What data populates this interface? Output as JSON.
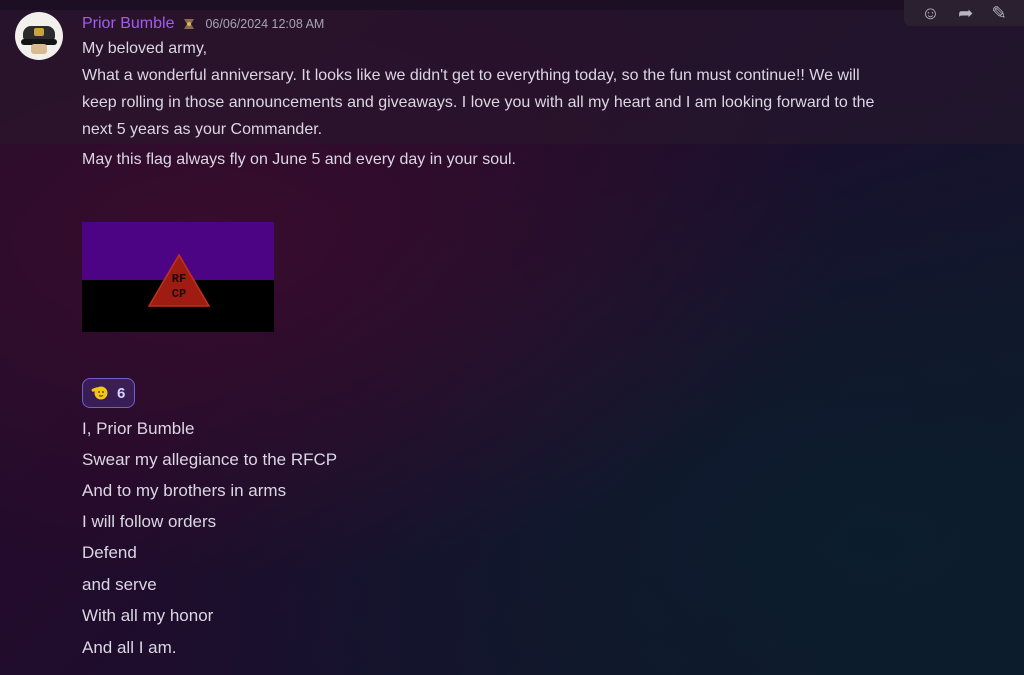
{
  "message": {
    "author": "Prior Bumble",
    "timestamp": "06/06/2024 12:08 AM",
    "lines": [
      "My beloved army,",
      "What a wonderful anniversary. It looks like we didn't get to everything today, so the fun must continue!! We will",
      "keep rolling in those announcements and giveaways. I love you with all my heart and I am looking forward to the",
      "next 5 years as your Commander."
    ],
    "followup": "May this flag always fly on June 5 and every day in your soul.",
    "attachment": {
      "flag_text_line1": "RF",
      "flag_text_line2": "CP",
      "colors": {
        "top": "#4d0484",
        "bottom": "#000000",
        "triangle": "#9e1c12"
      }
    },
    "reaction": {
      "emoji_name": "saluting-face-icon",
      "count": "6"
    }
  },
  "oath": {
    "lines": [
      "I, Prior Bumble",
      "Swear my allegiance to the RFCP",
      "And to my brothers in arms",
      "I will follow orders",
      "Defend",
      "and serve",
      "With all my honor",
      "And all I am."
    ]
  },
  "toolbar": {
    "icons": [
      "add-reaction-icon",
      "reply-icon",
      "edit-icon"
    ]
  },
  "colors": {
    "username": "#a25df0",
    "reaction_border": "#6e5ed1"
  }
}
